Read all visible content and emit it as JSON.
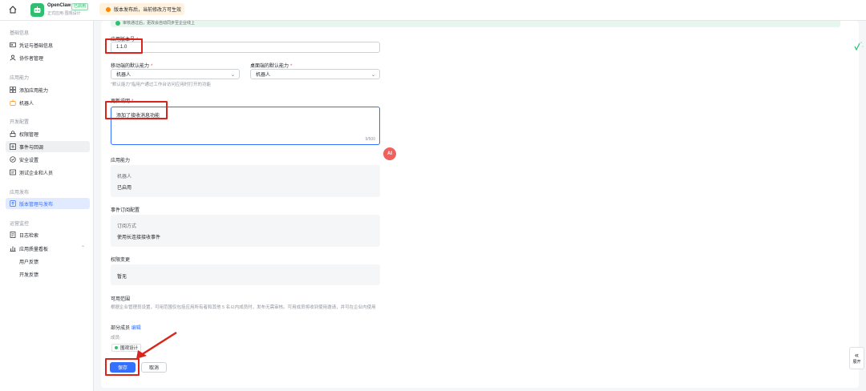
{
  "header": {
    "app_name": "OpenClaw",
    "app_badge": "已启用",
    "app_subtitle": "正式应用·围观设计",
    "notice": "版本发布后，当前修改方可生效"
  },
  "sidebar": {
    "groups": [
      {
        "title": "基础信息",
        "items": [
          "凭证与基础信息",
          "协作者管理"
        ]
      },
      {
        "title": "应用能力",
        "items": [
          "添加应用能力",
          "机器人"
        ]
      },
      {
        "title": "开发配置",
        "items": [
          "权限管理",
          "事件与回调",
          "安全设置",
          "测试企业和人员"
        ]
      },
      {
        "title": "应用发布",
        "items": [
          "版本管理与发布"
        ]
      },
      {
        "title": "运营监控",
        "items": [
          "日志检索",
          "应用质量看板"
        ],
        "sub_items": [
          "用户反馈",
          "开发反馈"
        ]
      }
    ]
  },
  "banner": {
    "text": "审核通过后，更改会自动同步至企业线上"
  },
  "form": {
    "version_label": "应用版本号",
    "version_value": "1.1.0",
    "mobile_label": "移动端的默认能力",
    "mobile_value": "机器人",
    "desktop_label": "桌面端的默认能力",
    "desktop_value": "机器人",
    "default_hint": "\"默认能力\"指用户通过工作台访问应用时打开的功能",
    "update_label": "更新说明",
    "update_value": "添加了接收消息功能",
    "update_count": "9/500",
    "ai_label": "AI",
    "ability_section": "应用能力",
    "ability_name": "机器人",
    "ability_status": "已启用",
    "event_section": "事件订阅配置",
    "event_name": "订阅方式",
    "event_value": "使用长连接接收事件",
    "perm_section": "权限变更",
    "perm_value": "暂无",
    "scope_section": "可用范围",
    "scope_desc": "根据企业管理员设置，可用范围仅包括应用所有者和其他 5 名以内成员时，发布无需审核。可用成员将收到使用邀请，并可在企业内使用",
    "partial_label": "部分成员",
    "edit_link": "编辑",
    "members_label": "成员:",
    "member_tag": "围观设计",
    "save_button": "保存",
    "cancel_button": "取消"
  },
  "expand": {
    "label": "展开"
  },
  "colors": {
    "primary": "#3370ff",
    "accent_green": "#2fbf71",
    "highlight_red": "#d9261c"
  }
}
